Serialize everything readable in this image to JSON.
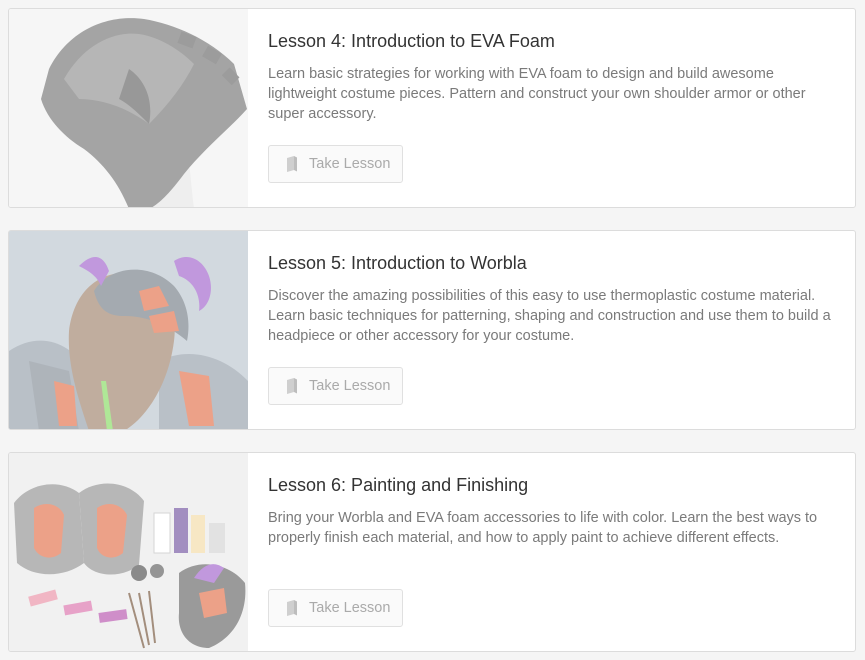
{
  "lessons": [
    {
      "title": "Lesson 4: Introduction to EVA Foam",
      "description": "Learn basic strategies for working with EVA foam to design and build awesome lightweight costume pieces. Pattern and construct your own shoulder armor or other super accessory.",
      "button_label": "Take Lesson",
      "button_icon": "book-icon",
      "image_subject": "eva-foam-shoulder-armor-image"
    },
    {
      "title": "Lesson 5: Introduction to Worbla",
      "description": "Discover the amazing possibilities of this easy to use thermoplastic costume material. Learn basic techniques for patterning, shaping and construction and use them to build a headpiece or other accessory for your costume.",
      "button_label": "Take Lesson",
      "button_icon": "book-icon",
      "image_subject": "worbla-headpiece-image"
    },
    {
      "title": "Lesson 6: Painting and Finishing",
      "description": "Bring your Worbla and EVA foam accessories to life with color. Learn the best ways to properly finish each material, and how to apply paint to achieve different effects.",
      "button_label": "Take Lesson",
      "button_icon": "book-icon",
      "image_subject": "painting-supplies-image"
    }
  ],
  "colors": {
    "page_background": "#f5f5f5",
    "card_border": "#dcdcdc",
    "title_text": "#333333",
    "description_text": "#7a7a7a",
    "button_text": "#aaaaaa"
  }
}
